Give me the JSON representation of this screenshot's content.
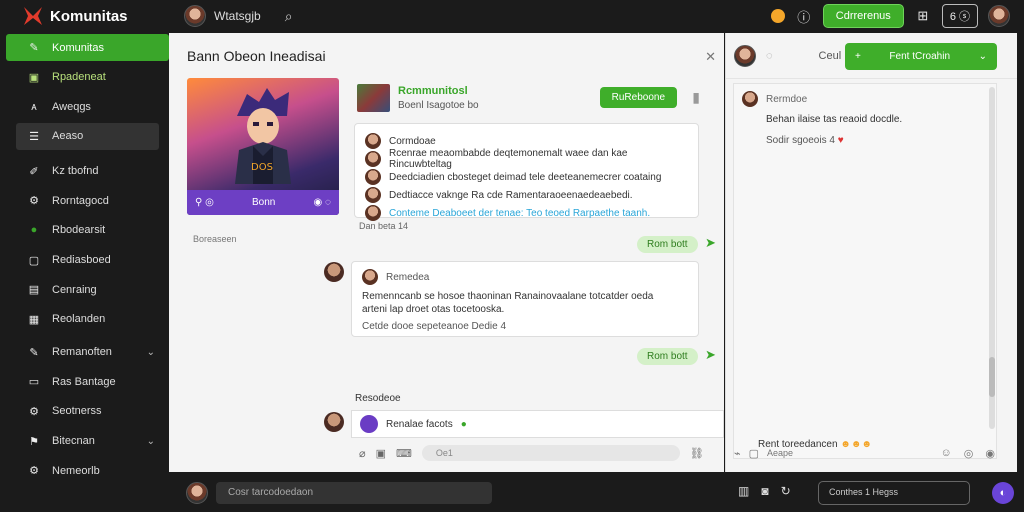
{
  "app": {
    "name": "Komunitas"
  },
  "topbar": {
    "user": "Wtatsgjb",
    "button_label": "Cdrrerenus",
    "count_label": "6"
  },
  "sidebar": {
    "items": [
      {
        "label": "Komunitas",
        "icon": "pencil-icon"
      },
      {
        "label": "Rpadeneat",
        "icon": "square-icon"
      },
      {
        "label": "Aweqgs",
        "icon": "aa-icon"
      },
      {
        "label": "Aeaso",
        "icon": "list-icon"
      },
      {
        "label": "Kz tbofnd",
        "icon": "pen-icon"
      },
      {
        "label": "Rorntagocd",
        "icon": "gear-icon"
      },
      {
        "label": "Rbodearsit",
        "icon": "green-dot-icon"
      },
      {
        "label": "Rediasboed",
        "icon": "box-icon"
      },
      {
        "label": "Cenraing",
        "icon": "doc-icon"
      },
      {
        "label": "Reolanden",
        "icon": "grid-icon"
      },
      {
        "label": "Remanoften",
        "icon": "pen-icon"
      },
      {
        "label": "Ras Bantage",
        "icon": "card-icon"
      },
      {
        "label": "Seotnerss",
        "icon": "gear-icon"
      },
      {
        "label": "Bitecnan",
        "icon": "flag-icon"
      },
      {
        "label": "Nemeorlb",
        "icon": "gear-icon"
      }
    ]
  },
  "main": {
    "title": "Bann Obeon Ineadisai",
    "game_card": {
      "bar_label": "Bonn",
      "art_text": "DOS"
    },
    "card_date": "Boreaseen",
    "post": {
      "title": "Rcmmunitosl",
      "subtitle": "Boenl  Isagotoe  bo",
      "button": "RuReboone"
    },
    "comment": {
      "name": "Cormdoae",
      "line1": "Rcenrae meaombabde deqtemonemalt waee dan kae Rincuwbteltag",
      "line2": "Deedciadien cbosteget deimad tele deeteanemecrer coataing",
      "line3": "Dedtiacce vaknge Ra cde Ramentaraoeenaedeaebedi.",
      "link": "Conteme Deaboeet der tenae: Teo teoed Rarpaethe taanh."
    },
    "meta1": "Dan beta  14",
    "pill1": "Rom bott",
    "reply": {
      "name": "Remedea",
      "line1": "Remenncanb se hosoe thaoninan Ranainovaalane totcatder oeda",
      "line2": "arteni lap droet otas tocetooska.",
      "line3": "Cetde dooe sepeteanoe  Dedie  4"
    },
    "pill2": "Rom bott",
    "section_label": "Resodeoe",
    "composer_text": "Renalae facots",
    "composer_placeholder": "Oe1"
  },
  "right": {
    "header_label": "Ceul",
    "button": "Fent tCroahin",
    "panel": {
      "name": "Rermdoe",
      "line1": "Behan ilaise tas reaoid docdle.",
      "line2": "Sodir sgoeois  4",
      "bottom": "Rent toreedancen"
    },
    "composer_placeholder": "Aeape"
  },
  "bottombar": {
    "input": "Cosr tarcodoedaon",
    "search": "Conthes 1 Hegss"
  }
}
